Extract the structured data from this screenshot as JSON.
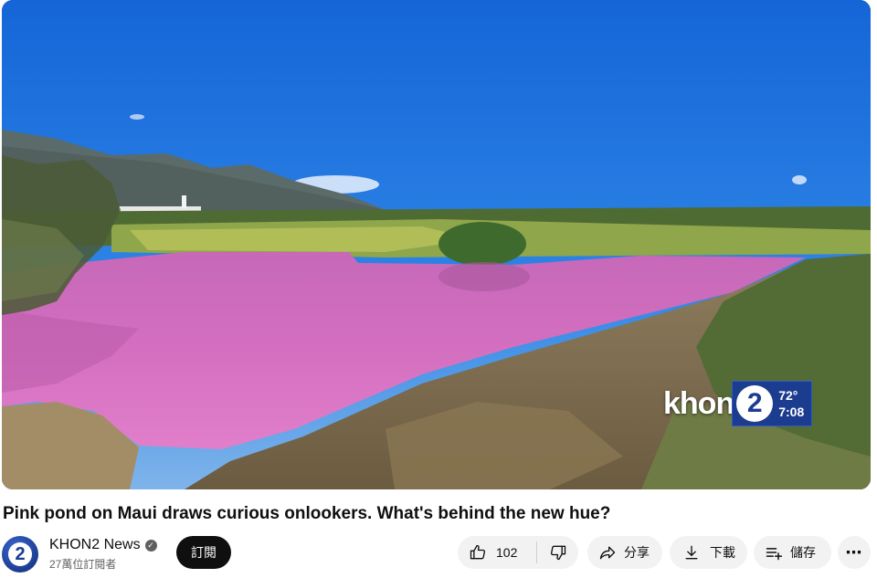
{
  "video": {
    "title": "Pink pond on Maui draws curious onlookers. What's behind the new hue?",
    "station_bug": {
      "logo_word": "khon",
      "logo_number": "2",
      "temperature": "72°",
      "time": "7:08"
    }
  },
  "channel": {
    "name": "KHON2 News",
    "subscribers": "27萬位訂閱者",
    "avatar_text": "2",
    "verified_icon": "✓"
  },
  "actions": {
    "subscribe_label": "訂閱",
    "like_count": "102",
    "share_label": "分享",
    "download_label": "下載",
    "save_label": "儲存",
    "more_label": "⋯"
  },
  "colors": {
    "accent_subscribe": "#0f0f0f",
    "pill_background": "#f2f2f2",
    "station_blue": "#1b3c8f"
  }
}
